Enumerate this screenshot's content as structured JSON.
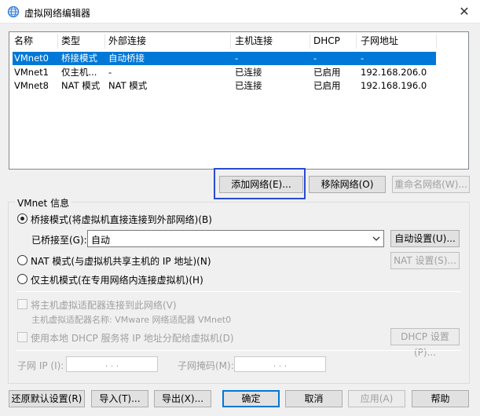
{
  "window": {
    "title": "虚拟网络编辑器",
    "close": "✕"
  },
  "table": {
    "headers": [
      "名称",
      "类型",
      "外部连接",
      "主机连接",
      "DHCP",
      "子网地址"
    ],
    "rows": [
      {
        "name": "VMnet0",
        "type": "桥接模式",
        "external": "自动桥接",
        "host": "-",
        "dhcp": "-",
        "subnet": "-",
        "selected": true
      },
      {
        "name": "VMnet1",
        "type": "仅主机...",
        "external": "-",
        "host": "已连接",
        "dhcp": "已启用",
        "subnet": "192.168.206.0",
        "selected": false
      },
      {
        "name": "VMnet8",
        "type": "NAT 模式",
        "external": "NAT 模式",
        "host": "已连接",
        "dhcp": "已启用",
        "subnet": "192.168.196.0",
        "selected": false
      }
    ]
  },
  "net_buttons": {
    "add": "添加网络(E)...",
    "remove": "移除网络(O)",
    "rename": "重命名网络(W)..."
  },
  "vmnet_info": {
    "title": "VMnet 信息",
    "bridged_label": "桥接模式(将虚拟机直接连接到外部网络)(B)",
    "bridged_to_label": "已桥接至(G):",
    "bridged_to_value": "自动",
    "auto_settings": "自动设置(U)...",
    "nat_label": "NAT 模式(与虚拟机共享主机的 IP 地址)(N)",
    "nat_settings": "NAT 设置(S)...",
    "hostonly_label": "仅主机模式(在专用网络内连接虚拟机)(H)",
    "connect_adapter_label": "将主机虚拟适配器连接到此网络(V)",
    "adapter_name_label": "主机虚拟适配器名称: VMware 网络适配器 VMnet0",
    "dhcp_label": "使用本地 DHCP 服务将 IP 地址分配给虚拟机(D)",
    "dhcp_settings": "DHCP 设置(P)...",
    "subnet_ip_label": "子网 IP (I):",
    "subnet_ip_value": ".     .     .",
    "subnet_mask_label": "子网掩码(M):",
    "subnet_mask_value": ".     .     ."
  },
  "footer": {
    "restore": "还原默认设置(R)",
    "import": "导入(T)...",
    "export": "导出(X)...",
    "ok": "确定",
    "cancel": "取消",
    "apply": "应用(A)",
    "help": "帮助"
  },
  "colors": {
    "selection": "#0078d7",
    "highlight_box": "#2a4bd1"
  }
}
